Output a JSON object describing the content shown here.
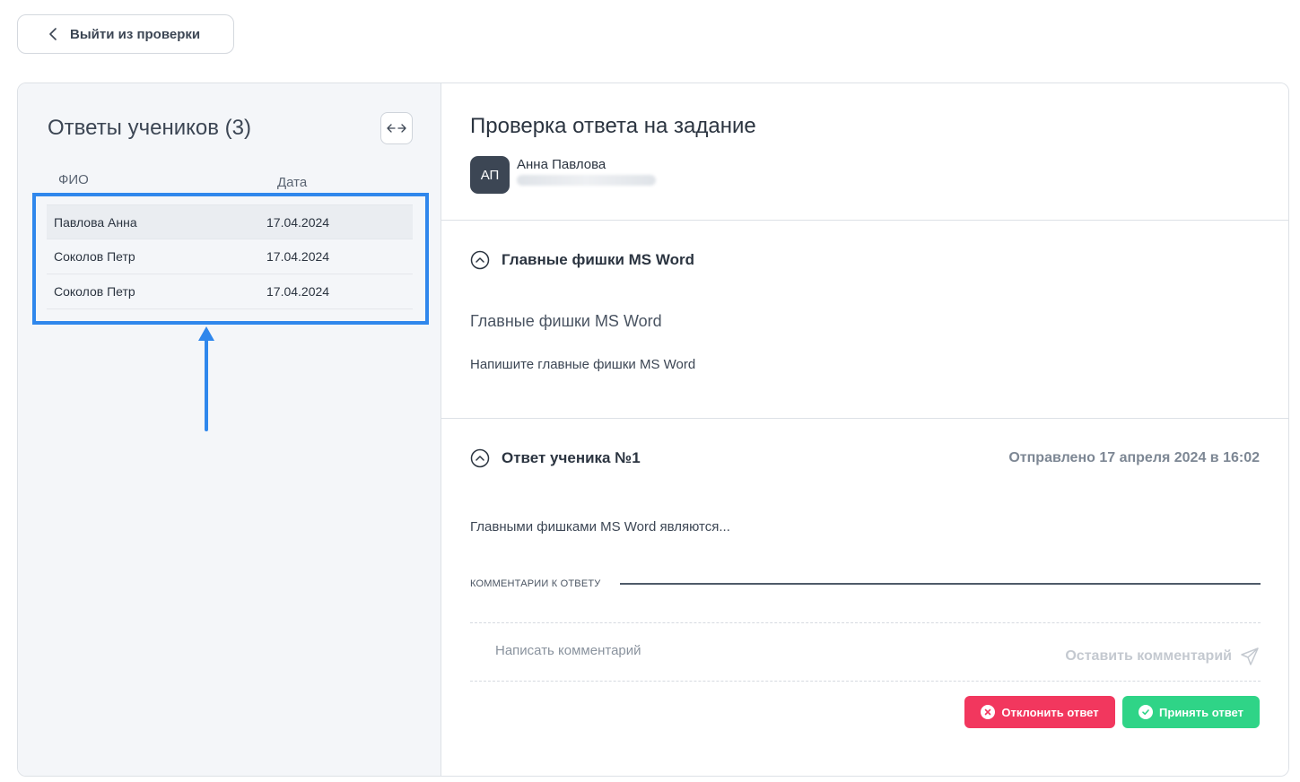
{
  "back_button": {
    "label": "Выйти из проверки",
    "icon": "chevron-left-icon"
  },
  "students_panel": {
    "title": "Ответы учеников (3)",
    "expand_icon": "arrows-horizontal-icon",
    "columns": {
      "name": "ФИО",
      "date": "Дата"
    },
    "rows": [
      {
        "name": "Павлова Анна",
        "date": "17.04.2024",
        "active": true
      },
      {
        "name": "Соколов Петр",
        "date": "17.04.2024",
        "active": false
      },
      {
        "name": "Соколов Петр",
        "date": "17.04.2024",
        "active": false
      }
    ],
    "highlight_color": "#2f87ec"
  },
  "review": {
    "title": "Проверка ответа на задание",
    "student": {
      "initials": "АП",
      "name": "Анна Павлова"
    },
    "task_section": {
      "header": "Главные фишки MS Word",
      "task_title": "Главные фишки MS Word",
      "task_text": "Напишите главные фишки MS Word"
    },
    "answer_section": {
      "header": "Ответ ученика №1",
      "sent": "Отправлено 17 апреля 2024 в 16:02",
      "text": "Главными фишками MS Word являются..."
    },
    "comments": {
      "label": "КОММЕНТАРИИ К ОТВЕТУ",
      "placeholder": "Написать комментарий",
      "submit_label": "Оставить комментарий",
      "submit_icon": "send-icon"
    },
    "actions": {
      "reject_label": "Отклонить ответ",
      "accept_label": "Принять ответ",
      "reject_color": "#f2375e",
      "accept_color": "#2fd487"
    }
  }
}
